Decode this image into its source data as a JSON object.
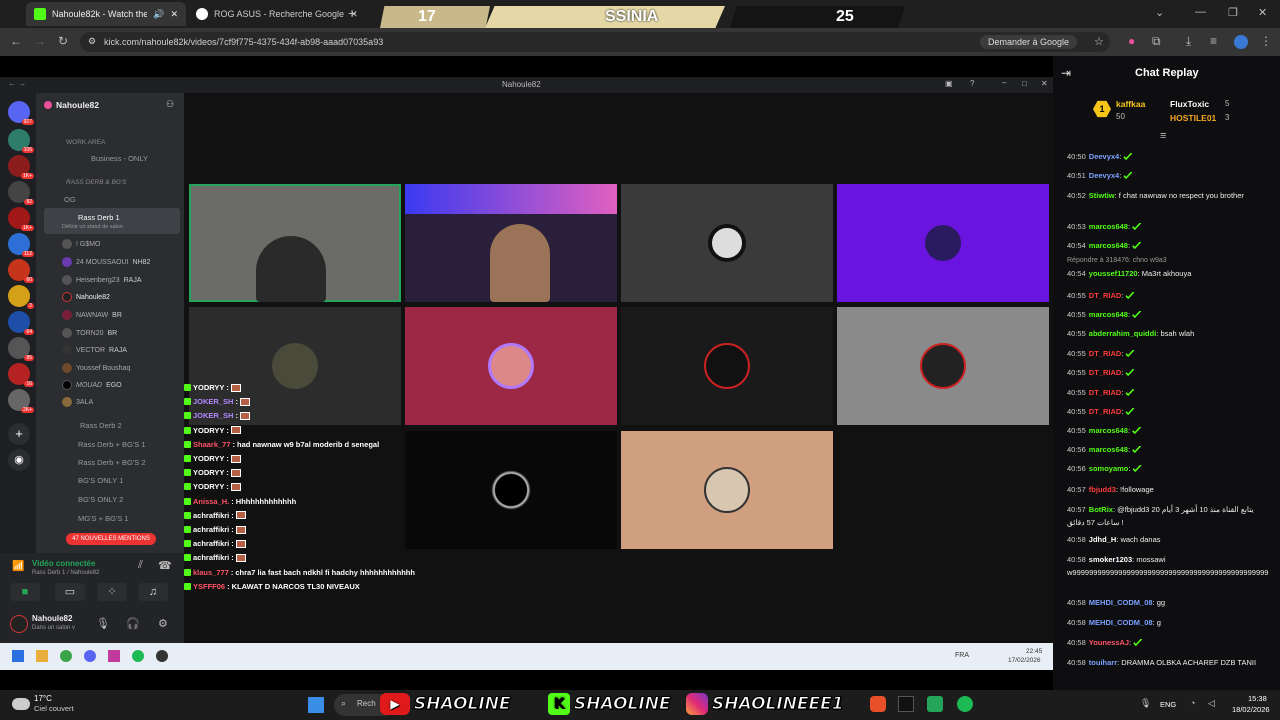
{
  "browser": {
    "tabs": [
      {
        "title": "Nahoule82k - Watch the VO",
        "active": true
      },
      {
        "title": "ROG ASUS - Recherche Google",
        "active": false
      }
    ],
    "url": "kick.com/nahoule82k/videos/7cf9f775-4375-434f-ab98-aaad07035a93",
    "ask_google": "Demander à Google",
    "new_tab": "+"
  },
  "score": {
    "left": "17",
    "title": "SSINIA",
    "right": "25"
  },
  "discord": {
    "window_title": "Nahoule82",
    "server_name": "Nahoule82",
    "server_badges": [
      "927",
      "106",
      "1K+",
      "82",
      "1K+",
      "112",
      "60",
      "2",
      "64",
      "85",
      "16",
      "2K+"
    ],
    "categories": {
      "work": "WORK AREA",
      "rass": "RASS DERB & BG'S"
    },
    "channels": {
      "business": "Business - ONLY",
      "og": "OG",
      "rass1": "Rass Derb 1",
      "status_hint": "Définir un statut de salon",
      "rass2": "Rass Derb 2",
      "rass_bg1": "Rass Derb + BG'S 1",
      "rass_bg2": "Rass Derb + BG'S 2",
      "bg1": "BG'S ONLY 1",
      "bg2": "BG'S ONLY 2",
      "mg1": "MG'S + BG'S 1"
    },
    "voice_users": [
      "! G$MO",
      "24 MOUSSAOUI",
      "Heisenberg23",
      "Nahoule82",
      "NAWNAW",
      "TORN20",
      "VECTOR",
      "Youssef Boushaq",
      "MOUAD",
      "3ALA"
    ],
    "user_tags": [
      "",
      "NH82",
      "RAJA",
      "",
      "BR",
      "BR",
      "RAJA",
      "",
      "EGO",
      ""
    ],
    "mentions": "47 NOUVELLES MENTIONS",
    "voice_status": "Vidéo connectée",
    "voice_channel": "Rass Derb 1 / Nahoule82",
    "me_name": "Nahoule82",
    "me_status": "Dans un salon v"
  },
  "overlay_chat": [
    {
      "user": "YODRYY",
      "msg": "",
      "color": "#ffffff"
    },
    {
      "user": "JOKER_SH",
      "msg": "",
      "color": "#b388ff"
    },
    {
      "user": "JOKER_SH",
      "msg": "",
      "color": "#b388ff"
    },
    {
      "user": "YODRYY",
      "msg": "",
      "color": "#ffffff"
    },
    {
      "user": "Shaark_77",
      "msg": "had nawnaw w9 b7al moderib d senegal",
      "color": "#ff5566"
    },
    {
      "user": "YODRYY",
      "msg": "",
      "color": "#ffffff"
    },
    {
      "user": "YODRYY",
      "msg": "",
      "color": "#ffffff"
    },
    {
      "user": "YODRYY",
      "msg": "",
      "color": "#ffffff"
    },
    {
      "user": "Anissa_H.",
      "msg": "Hhhhhhhhhhhhh",
      "color": "#ff5566"
    },
    {
      "user": "achraffikri",
      "msg": "",
      "color": "#ffffff"
    },
    {
      "user": "achraffikri",
      "msg": "",
      "color": "#ffffff"
    },
    {
      "user": "achraffikri",
      "msg": "",
      "color": "#ffffff"
    },
    {
      "user": "achraffikri",
      "msg": "",
      "color": "#ffffff"
    },
    {
      "user": "klaus_777",
      "msg": "chra7 lia fast bach ndkhl fi hadchy hhhhhhhhhhhh",
      "color": "#ff5566"
    },
    {
      "user": "YSFFF06",
      "msg": "KLAWAT D NARCOS TL30 NIVEAUX",
      "color": "#ff5566"
    }
  ],
  "chat_replay": {
    "title": "Chat Replay",
    "leaders": [
      {
        "rank": "1",
        "name": "kaffkaa",
        "count": "50"
      },
      {
        "name": "FluxToxic",
        "count": "5"
      },
      {
        "name": "HOSTILE01",
        "count": "3"
      }
    ],
    "reply_note": "Répondre à 318476: chno w9a3",
    "messages": [
      {
        "time": "40:50",
        "user": "Deevyx4",
        "color": "#7aa2ff",
        "msg": ""
      },
      {
        "time": "40:51",
        "user": "Deevyx4",
        "color": "#7aa2ff",
        "msg": ""
      },
      {
        "time": "40:52",
        "user": "Stiwtiw",
        "color": "#53fc18",
        "msg": "f chat nawnaw no respect you brother"
      },
      {
        "time": "40:53",
        "user": "marcos648",
        "color": "#53fc18",
        "msg": ""
      },
      {
        "time": "40:54",
        "user": "marcos648",
        "color": "#53fc18",
        "msg": ""
      },
      {
        "time": "40:54",
        "user": "youssef11720",
        "color": "#53fc18",
        "msg": "Ma3rt akhouya"
      },
      {
        "time": "40:55",
        "user": "DT_RIAD",
        "color": "#ff3b3b",
        "msg": ""
      },
      {
        "time": "40:55",
        "user": "marcos648",
        "color": "#53fc18",
        "msg": ""
      },
      {
        "time": "40:55",
        "user": "abderrahim_quiddi",
        "color": "#53fc18",
        "msg": "bsah wlah"
      },
      {
        "time": "40:55",
        "user": "DT_RIAD",
        "color": "#ff3b3b",
        "msg": ""
      },
      {
        "time": "40:55",
        "user": "DT_RIAD",
        "color": "#ff3b3b",
        "msg": ""
      },
      {
        "time": "40:55",
        "user": "DT_RIAD",
        "color": "#ff3b3b",
        "msg": ""
      },
      {
        "time": "40:55",
        "user": "DT_RIAD",
        "color": "#ff3b3b",
        "msg": ""
      },
      {
        "time": "40:55",
        "user": "marcos648",
        "color": "#53fc18",
        "msg": ""
      },
      {
        "time": "40:56",
        "user": "marcos648",
        "color": "#53fc18",
        "msg": ""
      },
      {
        "time": "40:56",
        "user": "somoyamo",
        "color": "#53fc18",
        "msg": ""
      },
      {
        "time": "40:57",
        "user": "fbjudd3",
        "color": "#ff3b3b",
        "msg": "!followage"
      },
      {
        "time": "40:57",
        "user": "BotRix",
        "color": "#53fc18",
        "msg": "@fbjudd3 يتابع القناة منذ 10 أشهر 3 أيام 20 ساعات 57 دقائق !"
      },
      {
        "time": "40:58",
        "user": "Jdhd_H",
        "color": "#ffffff",
        "msg": "wach danas"
      },
      {
        "time": "40:58",
        "user": "smoker1203",
        "color": "#ffffff",
        "msg": "mossawi w99999999999999999999999999999999999999999999999"
      },
      {
        "time": "40:58",
        "user": "MEHDI_CODM_08",
        "color": "#7aa2ff",
        "msg": "gg"
      },
      {
        "time": "40:58",
        "user": "MEHDI_CODM_08",
        "color": "#7aa2ff",
        "msg": "g"
      },
      {
        "time": "40:58",
        "user": "YounessAJ",
        "color": "#ff5566",
        "msg": ""
      },
      {
        "time": "40:58",
        "user": "touiharr",
        "color": "#7aa2ff",
        "msg": "DRAMMA OLBKA ACHAREF DZB TANII"
      }
    ]
  },
  "inner_taskbar": {
    "lang": "FRA",
    "time": "22:45",
    "date": "17/02/2026"
  },
  "outer_taskbar": {
    "weather_temp": "17°C",
    "weather_desc": "Ciel couvert",
    "search": "Rech",
    "lang": "ENG",
    "time": "15:38",
    "date": "18/02/2026"
  },
  "socials": {
    "youtube": "SHAOLINE",
    "kick": "SHAOLINE",
    "instagram": "SHAOLINEEE1"
  }
}
